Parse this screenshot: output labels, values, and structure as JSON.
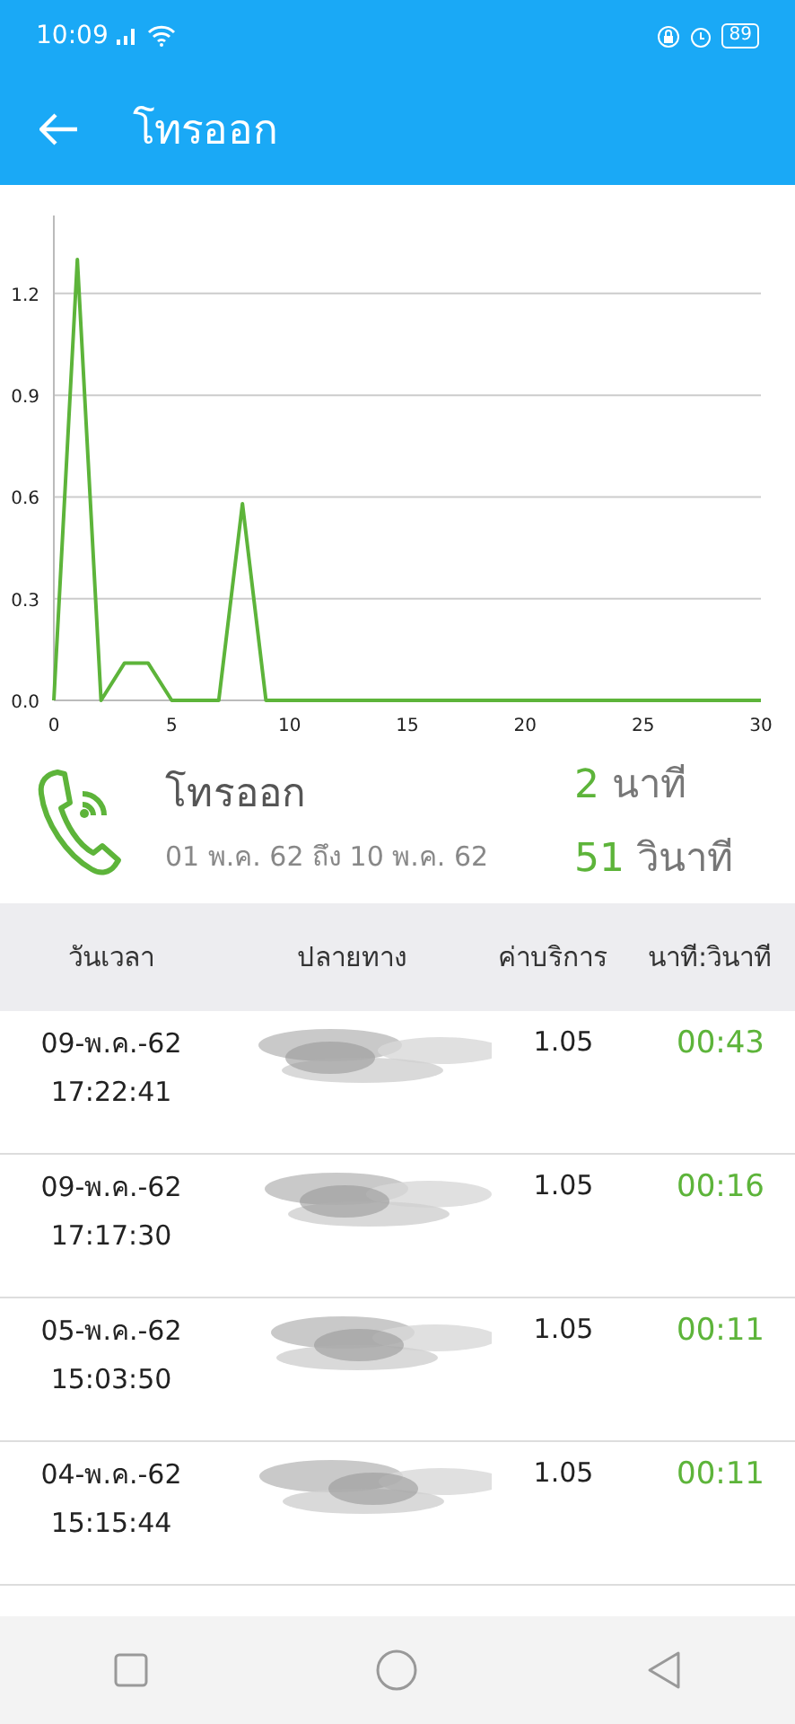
{
  "status_bar": {
    "time": "10:09",
    "battery": "89"
  },
  "app_bar": {
    "title": "โทรออก"
  },
  "chart": {
    "chart_data": {
      "type": "line",
      "x": [
        0,
        1,
        2,
        3,
        4,
        5,
        6,
        7,
        8,
        9,
        10,
        11,
        12,
        13,
        14,
        15,
        16,
        17,
        18,
        19,
        20,
        21,
        22,
        23,
        24,
        25,
        26,
        27,
        28,
        29,
        30
      ],
      "grid": true,
      "series": [
        {
          "color": "#5db43a",
          "values": [
            0,
            1.3,
            0,
            0.11,
            0.11,
            0,
            0,
            0,
            0.58,
            0,
            0,
            0,
            0,
            0,
            0,
            0,
            0,
            0,
            0,
            0,
            0,
            0,
            0,
            0,
            0,
            0,
            0,
            0,
            0,
            0,
            0
          ]
        }
      ],
      "xlim": [
        0,
        30
      ],
      "ylim": [
        0,
        1.43
      ],
      "xticks": [
        0,
        5,
        10,
        15,
        20,
        25,
        30
      ],
      "yticks": [
        {
          "value": 0,
          "label": "0.0"
        },
        {
          "value": 0.3,
          "label": "0.3"
        },
        {
          "value": 0.6,
          "label": "0.6"
        },
        {
          "value": 0.9,
          "label": "0.9"
        },
        {
          "value": 1.2,
          "label": "1.2"
        }
      ]
    }
  },
  "summary": {
    "title": "โทรออก",
    "period": "01 พ.ค. 62 ถึง 10 พ.ค. 62",
    "minutes": "2",
    "minutes_unit": "นาที",
    "seconds": "51",
    "seconds_unit": "วินาที"
  },
  "table": {
    "columns": [
      "วันเวลา",
      "ปลายทาง",
      "ค่าบริการ",
      "นาที:วินาที"
    ],
    "rows": [
      {
        "date": "09-พ.ค.-62",
        "time": "17:22:41",
        "fee": "1.05",
        "duration": "00:43"
      },
      {
        "date": "09-พ.ค.-62",
        "time": "17:17:30",
        "fee": "1.05",
        "duration": "00:16"
      },
      {
        "date": "05-พ.ค.-62",
        "time": "15:03:50",
        "fee": "1.05",
        "duration": "00:11"
      },
      {
        "date": "04-พ.ค.-62",
        "time": "15:15:44",
        "fee": "1.05",
        "duration": "00:11"
      }
    ]
  }
}
